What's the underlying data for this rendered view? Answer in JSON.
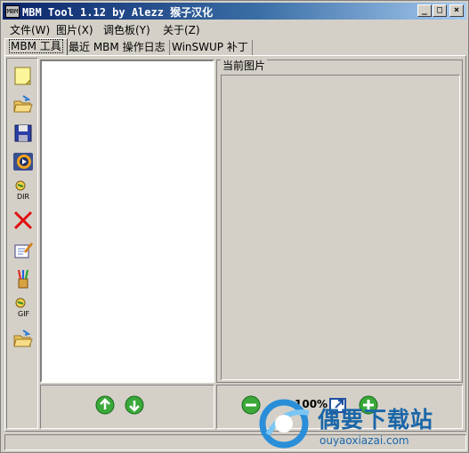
{
  "window": {
    "title": "MBM Tool 1.12 by Alezz 猴子汉化",
    "icon_text": "MBM",
    "controls": {
      "minimize": "_",
      "maximize": "□",
      "close": "×"
    }
  },
  "menu": [
    {
      "label": "文件(W)"
    },
    {
      "label": "图片(X)"
    },
    {
      "label": "调色板(Y)"
    },
    {
      "label": "关于(Z)"
    }
  ],
  "tabs": [
    {
      "label": "MBM 工具",
      "active": true
    },
    {
      "label": "最近 MBM 操作日志",
      "active": false
    },
    {
      "label": "WinSWUP 补丁",
      "active": false
    }
  ],
  "toolbar_icons": [
    "new-note-icon",
    "open-folder-icon",
    "save-disk-icon",
    "media-player-icon",
    "dir-scan-icon",
    "delete-x-icon",
    "edit-notepad-icon",
    "brushes-icon",
    "gif-export-icon",
    "open-folder-2-icon"
  ],
  "toolbar_text": {
    "dir": "DIR",
    "gif": "GIF"
  },
  "preview": {
    "group_label": "当前图片"
  },
  "zoom": {
    "value": "100%"
  },
  "watermark": {
    "title": "偶要下载站",
    "url": "ouyaoxiazai.com"
  }
}
